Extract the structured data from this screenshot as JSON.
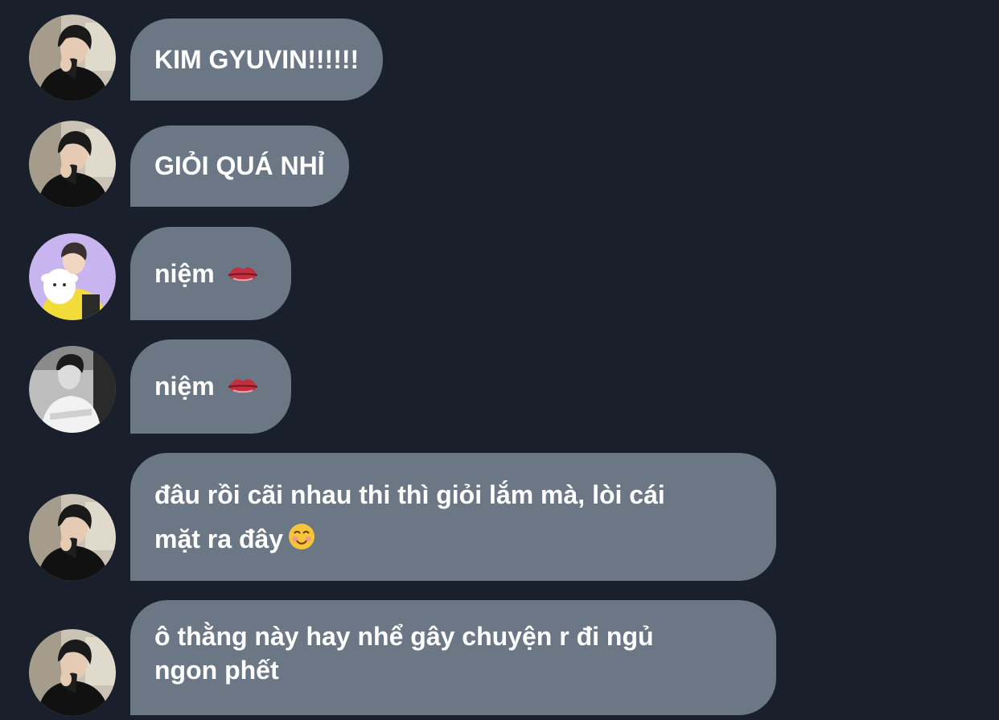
{
  "messages": [
    {
      "avatar": "avatar-dark-hair-man",
      "text": "KIM GYUVIN!!!!!!",
      "emoji": ""
    },
    {
      "avatar": "avatar-dark-hair-man",
      "text": "GIỎI QUÁ NHỈ",
      "emoji": ""
    },
    {
      "avatar": "avatar-boy-with-plush",
      "text": "niệm",
      "emoji": "lips-icon"
    },
    {
      "avatar": "avatar-monochrome-man",
      "text": "niệm",
      "emoji": "lips-icon"
    },
    {
      "avatar": "avatar-dark-hair-man",
      "text_line1": "đâu rồi cãi nhau thi thì giỏi lắm mà, lòi cái",
      "text_line2": "mặt ra đây",
      "emoji": "smiling-face-icon"
    },
    {
      "avatar": "avatar-dark-hair-man",
      "text_line1": "ô thằng này hay nhể gây chuyện r đi ngủ",
      "text_line2": "ngon phết",
      "emoji": ""
    }
  ],
  "colors": {
    "background": "#19202b",
    "bubble": "#6b7785",
    "text": "#ffffff"
  }
}
